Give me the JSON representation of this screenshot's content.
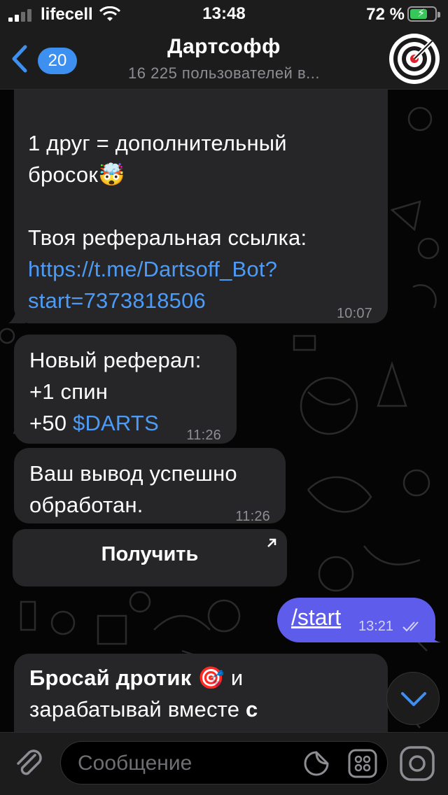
{
  "status_bar": {
    "carrier": "lifecell",
    "time": "13:48",
    "battery_percent": "72 %",
    "battery_level": 0.72,
    "charging": true
  },
  "header": {
    "back_count": "20",
    "title": "Дартсофф",
    "subtitle": "16 225 пользователей в..."
  },
  "messages": [
    {
      "type": "incoming",
      "lines": [
        "1 друг = дополнительный",
        "бросок🤯",
        "",
        "Твоя реферальная ссылка:"
      ],
      "link_lines": [
        "https://t.me/Dartsoff_Bot?",
        "start=7373818506"
      ],
      "time": "10:07"
    },
    {
      "type": "incoming",
      "lines": [
        "Новый реферал:",
        "+1 спин"
      ],
      "last_line_prefix": "+50 ",
      "last_line_link": "$DARTS",
      "time": "11:26"
    },
    {
      "type": "incoming",
      "lines": [
        "Ваш вывод успешно",
        "обработан."
      ],
      "time": "11:26"
    },
    {
      "type": "inline_button",
      "label": "Получить"
    },
    {
      "type": "outgoing",
      "text": "/start",
      "time": "13:21"
    },
    {
      "type": "incoming",
      "line1_bold": "Бросай дротик",
      "line1_emoji": "🎯",
      "line1_rest": " и",
      "line2_text": "зарабатывай вместе ",
      "line2_bold": "с"
    }
  ],
  "input": {
    "placeholder": "Сообщение"
  },
  "icons": {
    "back": "chevron-left-icon",
    "attach": "paperclip-icon",
    "sticker": "sticker-icon",
    "commands": "bot-menu-icon",
    "camera": "camera-icon",
    "scroll_down": "chevron-down-icon"
  },
  "colors": {
    "accent": "#3d8ff0",
    "outgoing_bubble": "#5e5cea",
    "incoming_bubble": "#262628",
    "link": "#4d9bf5"
  }
}
